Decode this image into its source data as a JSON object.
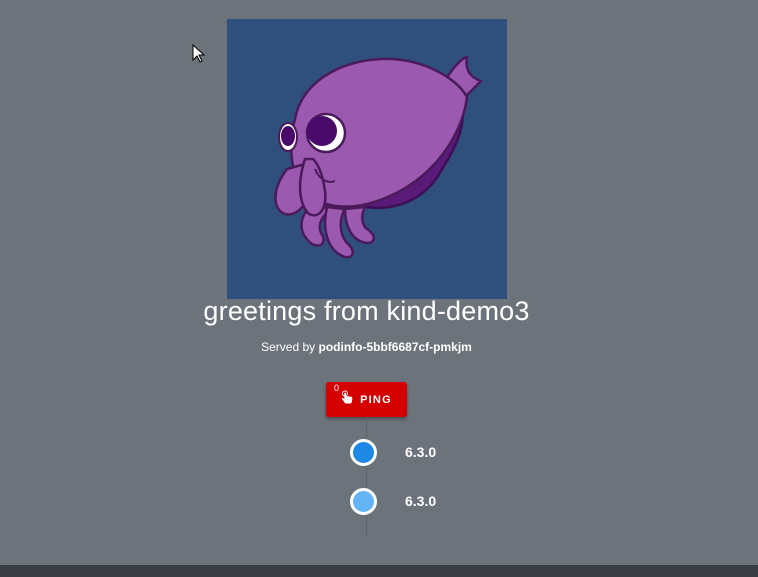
{
  "header": {
    "title": "greetings from kind-demo3",
    "served_prefix": "Served by",
    "served_host": "podinfo-5bbf6687cf-pmkjm"
  },
  "logo": {
    "icon": "cuttlefish-mascot-icon",
    "background_color": "#2f4f7c",
    "body_color": "#9b59b0"
  },
  "ping_button": {
    "label": "PING",
    "count": "0",
    "icon": "touch-app-icon",
    "color": "#d50000"
  },
  "timeline": {
    "items": [
      {
        "version": "6.3.0",
        "dot_color": "#1e88e5"
      },
      {
        "version": "6.3.0",
        "dot_color": "#64b5f6"
      }
    ]
  },
  "colors": {
    "page_background": "#6c737a",
    "text": "#ffffff"
  }
}
